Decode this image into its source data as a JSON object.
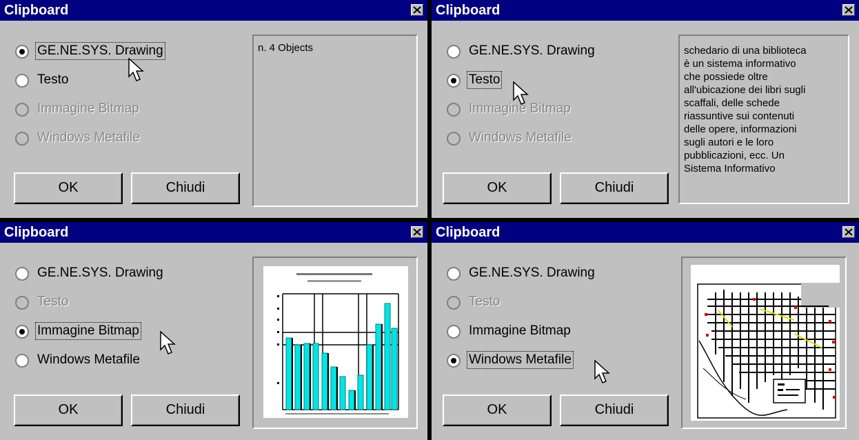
{
  "dialogs": [
    {
      "title": "Clipboard",
      "options": [
        "GE.NE.SYS. Drawing",
        "Testo",
        "Immagine Bitmap",
        "Windows Metafile"
      ],
      "selected": "GE.NE.SYS. Drawing",
      "disabled": [
        "Immagine Bitmap",
        "Windows Metafile"
      ],
      "ok_label": "OK",
      "close_label": "Chiudi",
      "preview_text": [
        "n. 4 Objects"
      ]
    },
    {
      "title": "Clipboard",
      "options": [
        "GE.NE.SYS. Drawing",
        "Testo",
        "Immagine Bitmap",
        "Windows Metafile"
      ],
      "selected": "Testo",
      "disabled": [
        "Immagine Bitmap",
        "Windows Metafile"
      ],
      "ok_label": "OK",
      "close_label": "Chiudi",
      "preview_text": [
        "schedario di una biblioteca",
        "è un sistema informativo",
        "che possiede oltre",
        "all'ubicazione dei libri sugli",
        "scaffali, delle schede",
        "riassuntive sui contenuti",
        "delle opere, informazioni",
        "sugli autori e le loro",
        "pubblicazioni, ecc. Un",
        "Sistema Informativo"
      ]
    },
    {
      "title": "Clipboard",
      "options": [
        "GE.NE.SYS. Drawing",
        "Testo",
        "Immagine Bitmap",
        "Windows Metafile"
      ],
      "selected": "Immagine Bitmap",
      "disabled": [
        "Testo"
      ],
      "ok_label": "OK",
      "close_label": "Chiudi",
      "preview": "bitmap-chart"
    },
    {
      "title": "Clipboard",
      "options": [
        "GE.NE.SYS. Drawing",
        "Testo",
        "Immagine Bitmap",
        "Windows Metafile"
      ],
      "selected": "Windows Metafile",
      "disabled": [
        "Testo"
      ],
      "ok_label": "OK",
      "close_label": "Chiudi",
      "preview": "metafile-map"
    }
  ],
  "colors": {
    "titlebar": "#000080",
    "face": "#c0c0c0",
    "chart_bar": "#00e5e5",
    "map_accent": "#e00000"
  }
}
